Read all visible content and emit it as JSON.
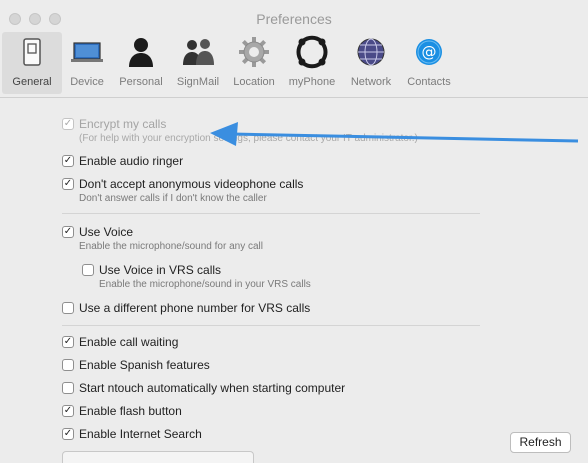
{
  "window": {
    "title": "Preferences"
  },
  "toolbar": {
    "items": [
      {
        "label": "General",
        "icon": "general-icon"
      },
      {
        "label": "Device",
        "icon": "device-icon"
      },
      {
        "label": "Personal",
        "icon": "personal-icon"
      },
      {
        "label": "SignMail",
        "icon": "signmail-icon"
      },
      {
        "label": "Location",
        "icon": "location-icon"
      },
      {
        "label": "myPhone",
        "icon": "myphone-icon"
      },
      {
        "label": "Network",
        "icon": "network-icon"
      },
      {
        "label": "Contacts",
        "icon": "contacts-icon"
      }
    ],
    "selected": "General"
  },
  "settings": {
    "encrypt": {
      "label": "Encrypt my calls",
      "sub": "(For help with your encryption settings, please contact your IT administrator.)",
      "checked": true,
      "disabled": true
    },
    "audio_ringer": {
      "label": "Enable audio ringer",
      "checked": true
    },
    "anonymous": {
      "label": "Don't accept anonymous videophone calls",
      "sub": "Don't answer calls if I don't know the caller",
      "checked": true
    },
    "use_voice": {
      "label": "Use Voice",
      "sub": "Enable the microphone/sound for any call",
      "checked": true
    },
    "voice_vrs": {
      "label": "Use Voice in VRS calls",
      "sub": "Enable the microphone/sound in your VRS calls",
      "checked": false
    },
    "different_number": {
      "label": "Use a different phone number for VRS calls",
      "checked": false
    },
    "call_waiting": {
      "label": "Enable call waiting",
      "checked": true
    },
    "spanish": {
      "label": "Enable Spanish features",
      "checked": false
    },
    "start_auto": {
      "label": "Start ntouch automatically when starting computer",
      "checked": false
    },
    "flash_button": {
      "label": "Enable flash button",
      "checked": true
    },
    "internet_search": {
      "label": "Enable Internet Search",
      "checked": true
    }
  },
  "buttons": {
    "refresh": "Refresh"
  },
  "colors": {
    "arrow": "#3a8ee0",
    "contacts_icon": "#1a8fe3",
    "window_bg": "#ececec"
  }
}
